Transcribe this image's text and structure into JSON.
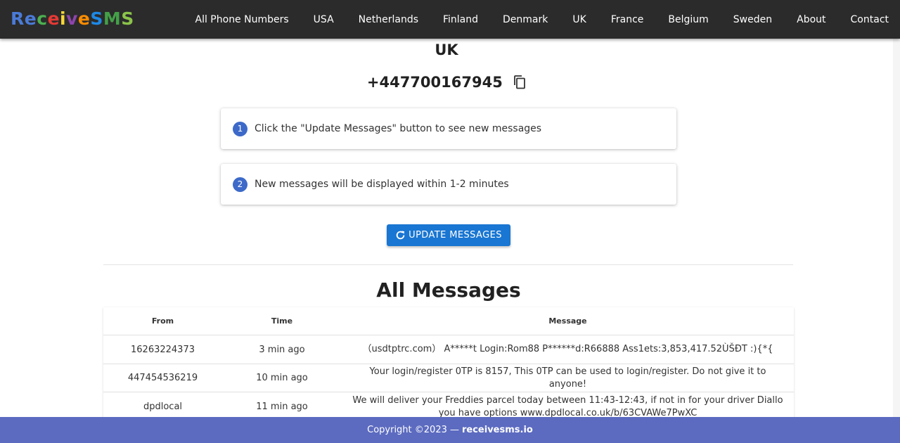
{
  "logo": {
    "text": "ReceiveSMS",
    "letters": [
      {
        "ch": "R",
        "color": "#4a7bd8"
      },
      {
        "ch": "e",
        "color": "#4a7bd8"
      },
      {
        "ch": "c",
        "color": "#4caf50"
      },
      {
        "ch": "e",
        "color": "#e53935"
      },
      {
        "ch": "i",
        "color": "#fdd835"
      },
      {
        "ch": "v",
        "color": "#8e44ad"
      },
      {
        "ch": "e",
        "color": "#fb8c00"
      },
      {
        "ch": "S",
        "color": "#1e88e5"
      },
      {
        "ch": "M",
        "color": "#43a047"
      },
      {
        "ch": "S",
        "color": "#8bc34a"
      }
    ]
  },
  "nav": {
    "items": [
      "All Phone Numbers",
      "USA",
      "Netherlands",
      "Finland",
      "Denmark",
      "UK",
      "France",
      "Belgium",
      "Sweden",
      "About",
      "Contact"
    ]
  },
  "main": {
    "country": "UK",
    "phone": "+447700167945",
    "steps": [
      {
        "num": "1",
        "text": "Click the \"Update Messages\" button to see new messages"
      },
      {
        "num": "2",
        "text": "New messages will be displayed within 1-2 minutes"
      }
    ],
    "update_button": "UPDATE MESSAGES",
    "messages_title": "All Messages"
  },
  "table": {
    "headers": [
      "From",
      "Time",
      "Message"
    ],
    "rows": [
      {
        "from": "16263224373",
        "time": "3 min ago",
        "message": "（usdtptrc.com） A*****t Login:Rom88 P******d:R66888 Ass1ets:3,853,417.52ÙŠĐT :){*{"
      },
      {
        "from": "447454536219",
        "time": "10 min ago",
        "message": "Your login/register 0TP is 8157, This 0TP can be used to login/register. Do not give it to anyone!"
      },
      {
        "from": "dpdlocal",
        "time": "11 min ago",
        "message": "We will deliver your Freddies parcel today between 11:43-12:43, if not in for your driver Diallo you have options www.dpdlocal.co.uk/b/63CVAWe7PwXC"
      }
    ]
  },
  "footer": {
    "copyright": "Copyright ©2023 —",
    "site": "receivesms.io"
  },
  "colors": {
    "header_bg": "#2b2b2b",
    "accent": "#1976d2",
    "step_badge": "#3d6ac9",
    "footer_bg": "#5c6bc0"
  },
  "icons": {
    "copy": "copy-icon",
    "refresh": "refresh-icon"
  }
}
